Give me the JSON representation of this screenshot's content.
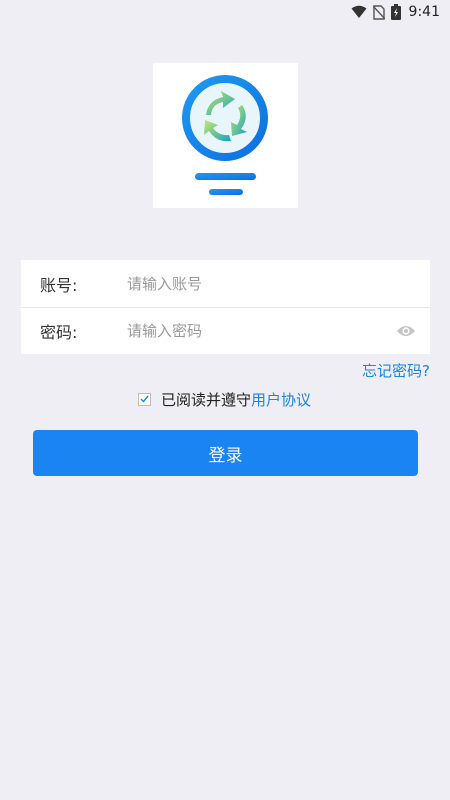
{
  "status_bar": {
    "time": "9:41",
    "icons": [
      "wifi-icon",
      "no-sim-icon",
      "battery-charging-icon"
    ]
  },
  "logo": {
    "icon": "recycle-bulb-logo",
    "colors": {
      "ring": "#1a8ef0",
      "arrows_light": "#b8e36a",
      "arrows_dark": "#1fa3b8"
    }
  },
  "form": {
    "account": {
      "label": "账号:",
      "placeholder": "请输入账号",
      "value": ""
    },
    "password": {
      "label": "密码:",
      "placeholder": "请输入密码",
      "value": "",
      "toggle_icon": "eye-icon"
    }
  },
  "forgot_password": "忘记密码?",
  "agreement": {
    "checked": true,
    "text": "已阅读并遵守",
    "link": "用户协议"
  },
  "login_button": "登录",
  "colors": {
    "accent": "#1a84f2",
    "link": "#1a84e6",
    "background": "#eeeef4"
  }
}
